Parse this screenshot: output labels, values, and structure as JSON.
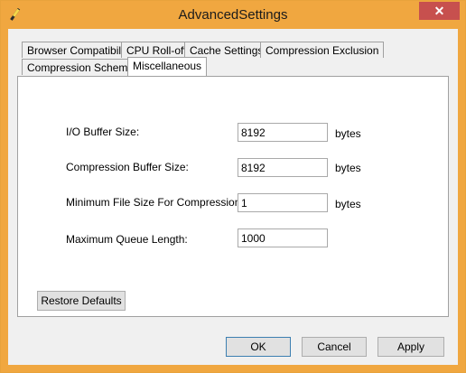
{
  "window": {
    "title": "AdvancedSettings",
    "close_glyph": "✕",
    "accent_color": "#f0a740"
  },
  "tabs": {
    "row1": [
      "Browser Compatibility",
      "CPU Roll-off",
      "Cache Settings",
      "Compression Exclusion"
    ],
    "row2": [
      "Compression Schemes",
      "Miscellaneous"
    ],
    "active": "Miscellaneous"
  },
  "fields": [
    {
      "label": "I/O Buffer Size:",
      "value": "8192",
      "unit": "bytes"
    },
    {
      "label": "Compression Buffer Size:",
      "value": "8192",
      "unit": "bytes"
    },
    {
      "label": "Minimum File Size For Compression:",
      "value": "1",
      "unit": "bytes"
    },
    {
      "label": "Maximum Queue Length:",
      "value": "1000",
      "unit": ""
    }
  ],
  "buttons": {
    "restore": "Restore Defaults",
    "ok": "OK",
    "cancel": "Cancel",
    "apply": "Apply"
  }
}
